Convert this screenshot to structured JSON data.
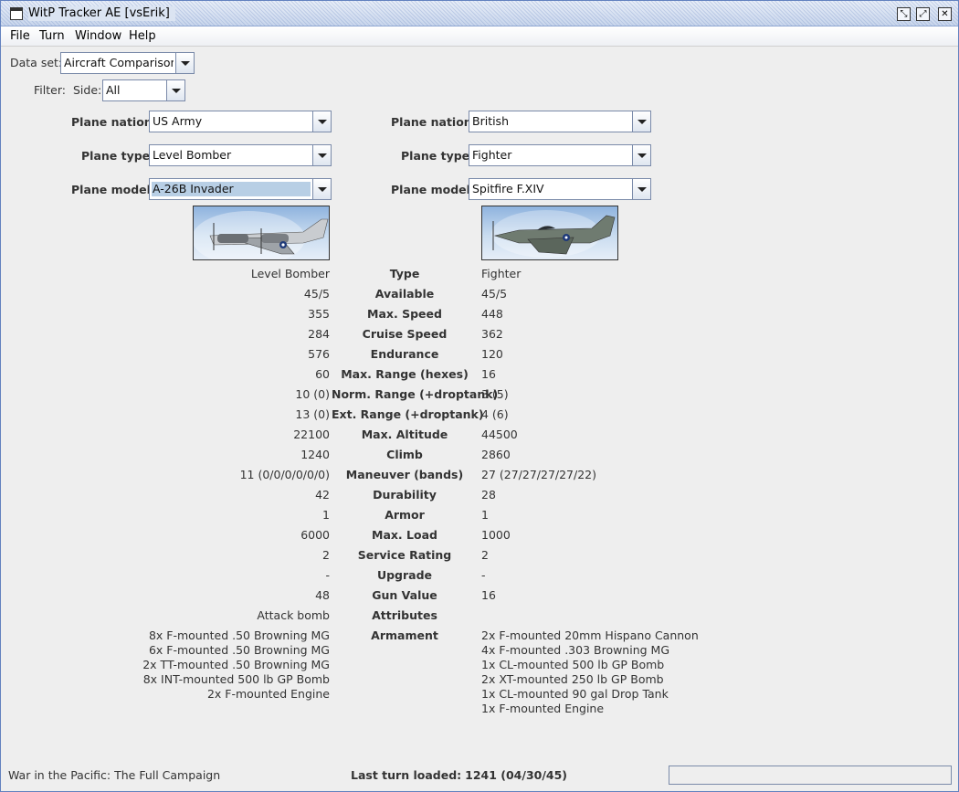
{
  "window": {
    "title": "WitP Tracker AE [vsErik]"
  },
  "menu": [
    {
      "label": "File"
    },
    {
      "label": "Turn"
    },
    {
      "label": "Window"
    },
    {
      "label": "Help"
    }
  ],
  "dataset": {
    "label": "Data set:",
    "value": "Aircraft Comparison"
  },
  "filter": {
    "label": "Filter:",
    "side_label": "Side:",
    "side_value": "All"
  },
  "left": {
    "nation_label": "Plane nation:",
    "nation": "US Army",
    "type_label": "Plane type:",
    "type": "Level Bomber",
    "model_label": "Plane model:",
    "model": "A-26B Invader"
  },
  "right": {
    "nation_label": "Plane nation:",
    "nation": "British",
    "type_label": "Plane type:",
    "type": "Fighter",
    "model_label": "Plane model:",
    "model": "Spitfire F.XIV"
  },
  "rows": [
    {
      "label": "Type",
      "left": "Level Bomber",
      "right": "Fighter"
    },
    {
      "label": "Available",
      "left": "45/5",
      "right": "45/5"
    },
    {
      "label": "Max. Speed",
      "left": "355",
      "right": "448"
    },
    {
      "label": "Cruise Speed",
      "left": "284",
      "right": "362"
    },
    {
      "label": "Endurance",
      "left": "576",
      "right": "120"
    },
    {
      "label": "Max. Range (hexes)",
      "left": "60",
      "right": "16"
    },
    {
      "label": "Norm. Range (+droptank)",
      "left": "10 (0)",
      "right": "3 (5)"
    },
    {
      "label": "Ext. Range (+droptank)",
      "left": "13 (0)",
      "right": "4 (6)"
    },
    {
      "label": "Max. Altitude",
      "left": "22100",
      "right": "44500"
    },
    {
      "label": "Climb",
      "left": "1240",
      "right": "2860"
    },
    {
      "label": "Maneuver (bands)",
      "left": "11 (0/0/0/0/0/0)",
      "right": "27 (27/27/27/27/22)"
    },
    {
      "label": "Durability",
      "left": "42",
      "right": "28"
    },
    {
      "label": "Armor",
      "left": "1",
      "right": "1"
    },
    {
      "label": "Max. Load",
      "left": "6000",
      "right": "1000"
    },
    {
      "label": "Service Rating",
      "left": "2",
      "right": "2"
    },
    {
      "label": "Upgrade",
      "left": "-",
      "right": "-"
    },
    {
      "label": "Gun Value",
      "left": "48",
      "right": "16"
    },
    {
      "label": "Attributes",
      "left": "Attack bomb",
      "right": ""
    }
  ],
  "armament": {
    "label": "Armament",
    "left": [
      "8x F-mounted .50 Browning MG",
      "6x F-mounted .50 Browning MG",
      "2x TT-mounted .50 Browning MG",
      "8x INT-mounted 500 lb GP Bomb",
      "2x F-mounted Engine"
    ],
    "right": [
      "2x F-mounted 20mm Hispano Cannon",
      "4x F-mounted .303 Browning MG",
      "1x CL-mounted 500 lb GP Bomb",
      "2x XT-mounted 250 lb GP Bomb",
      "1x CL-mounted 90 gal Drop Tank",
      "1x F-mounted Engine"
    ]
  },
  "status": {
    "campaign": "War in the Pacific: The Full Campaign",
    "last_turn_label": "Last turn loaded:",
    "last_turn_value": "1241 (04/30/45)"
  }
}
